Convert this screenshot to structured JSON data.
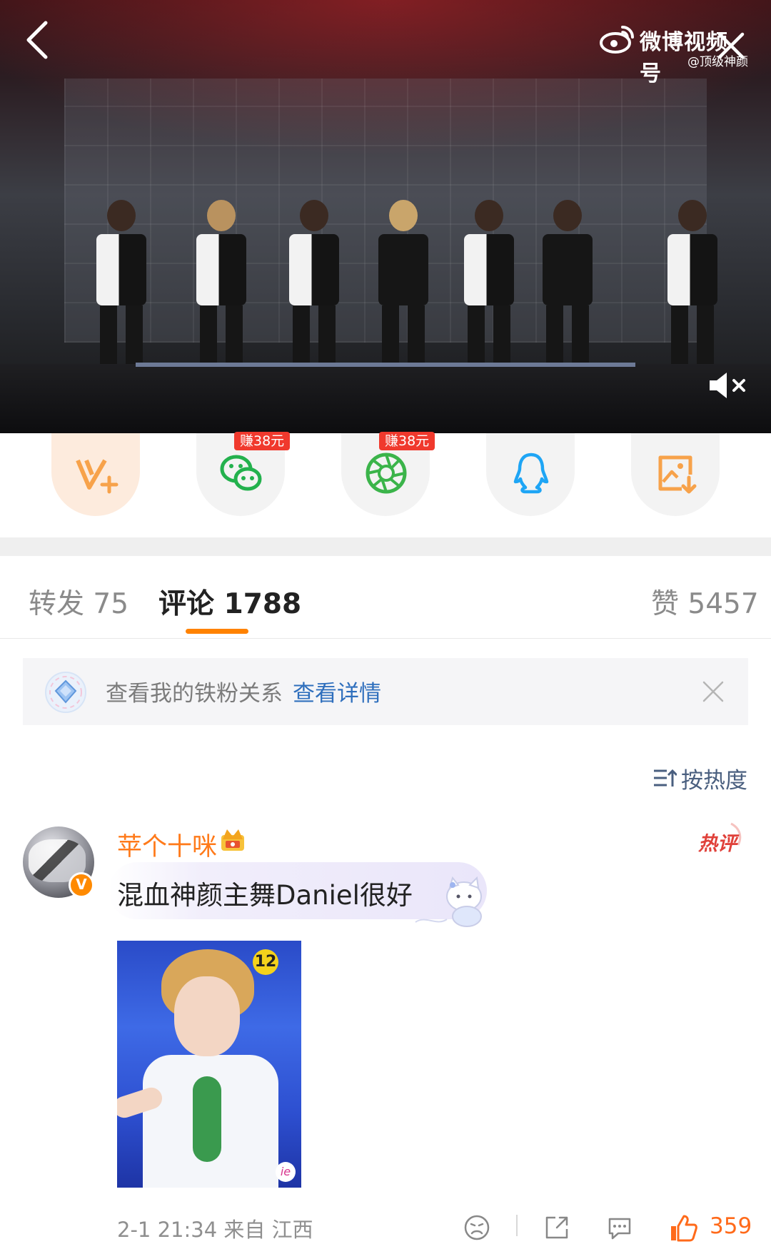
{
  "video": {
    "watermark_brand": "微博视频号",
    "watermark_handle": "@顶级神颜",
    "icons": [
      "back-arrow-icon",
      "weibo-logo-icon",
      "close-icon",
      "mute-icon"
    ]
  },
  "share": {
    "items": [
      {
        "name": "v-plus",
        "icon": "v-plus-icon",
        "badge": ""
      },
      {
        "name": "wechat",
        "icon": "wechat-icon",
        "badge": "赚38元"
      },
      {
        "name": "moments",
        "icon": "moments-aperture-icon",
        "badge": "赚38元"
      },
      {
        "name": "qq",
        "icon": "qq-penguin-icon",
        "badge": ""
      },
      {
        "name": "save-image",
        "icon": "save-image-icon",
        "badge": ""
      }
    ]
  },
  "tabs": {
    "repost": "转发 75",
    "comments": "评论 1788",
    "likes": "赞 5457",
    "active": "comments",
    "accent": "#ff8200"
  },
  "fan_banner": {
    "text": "查看我的铁粉关系",
    "link": "查看详情"
  },
  "sort": {
    "label": "按热度",
    "icon": "sort-icon"
  },
  "comment": {
    "username": "苹个十咪",
    "verified_badge": "V",
    "hot_tag": "热评",
    "text": "混血神颜主舞Daniel很好",
    "image_tag": "12",
    "image_watermark": "ie",
    "time": "2-1 21:34",
    "location": "来自 江西",
    "like_count": "359",
    "colors": {
      "username": "#ff7a1a",
      "like": "#ff6a1a",
      "hot": "#e0413a"
    }
  }
}
